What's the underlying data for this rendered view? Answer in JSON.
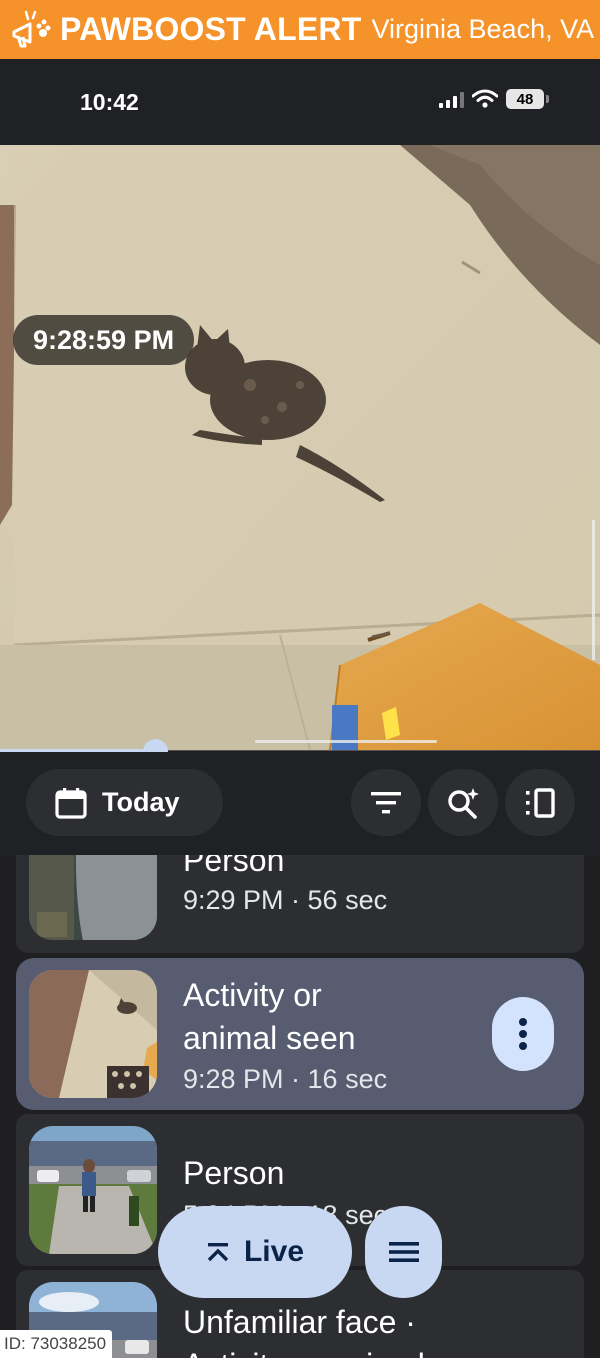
{
  "banner": {
    "brand": "PAWBOOST ALERT",
    "location": "Virginia Beach, VA",
    "icon": "megaphone-paw-icon",
    "color": "#f5922a"
  },
  "status_bar": {
    "time": "10:42",
    "battery": "48",
    "icons": [
      "cellular-signal-icon",
      "wifi-icon",
      "battery-icon"
    ]
  },
  "video": {
    "timestamp": "9:28:59 PM"
  },
  "toolbar": {
    "date_label": "Today",
    "date_icon": "calendar-icon",
    "buttons": [
      "filter-icon",
      "smart-search-icon",
      "view-toggle-icon"
    ]
  },
  "events": [
    {
      "title": "Person",
      "meta": "9:29 PM · 56 sec",
      "selected": false
    },
    {
      "title_line1": "Activity or",
      "title_line2": "animal seen",
      "meta": "9:28 PM · 16 sec",
      "selected": true
    },
    {
      "title": "Person",
      "meta": "5:34 PM · 18 sec",
      "selected": false
    },
    {
      "title_line1": "Unfamiliar face ·",
      "title_line2": "Activity or animal seen",
      "selected": false
    }
  ],
  "bottom_actions": {
    "live_label": "Live",
    "live_icon": "chevron-up-double-icon",
    "menu_icon": "menu-icon"
  },
  "watermark": {
    "id_text": "ID: 73038250"
  },
  "colors": {
    "accent": "#c8d7f2",
    "selected_card": "#575c70",
    "card": "#2d2e31",
    "background": "#1f1f21"
  }
}
